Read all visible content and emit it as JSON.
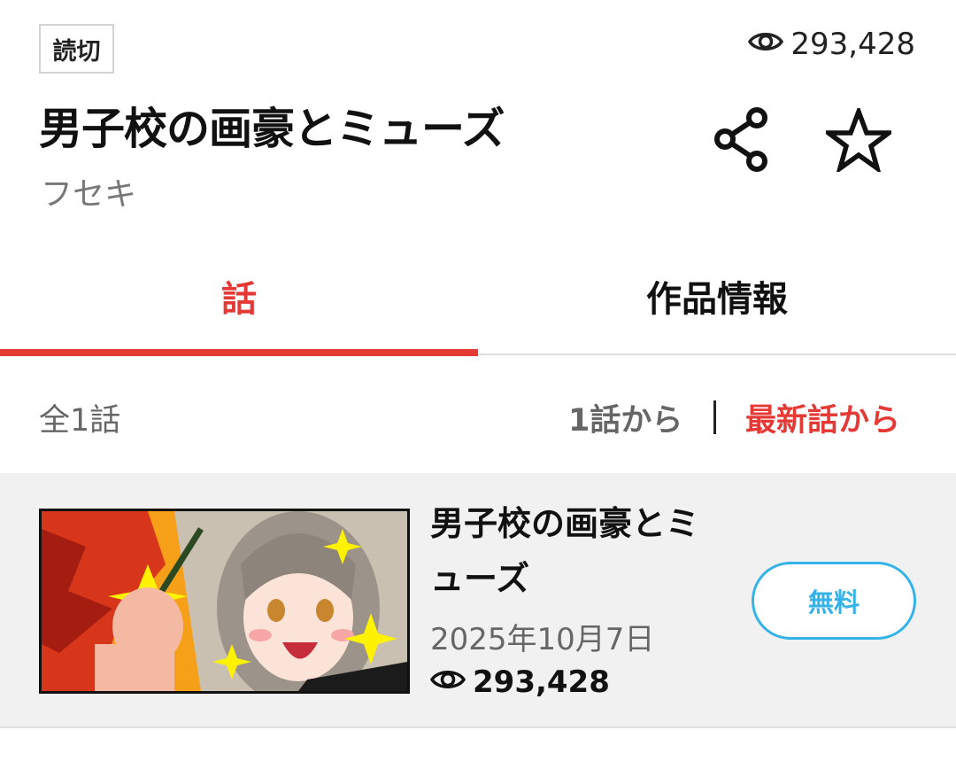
{
  "work": {
    "badge": "読切",
    "views": "293,428",
    "title": "男子校の画豪とミューズ",
    "author": "フセキ"
  },
  "icons": {
    "views": "eye-icon",
    "share": "share-icon",
    "favorite": "star-outline-icon"
  },
  "tabs": [
    {
      "label": "話",
      "active": true
    },
    {
      "label": "作品情報",
      "active": false
    }
  ],
  "list": {
    "count": "全1話",
    "sort_first": "1話から",
    "sort_latest": "最新話から"
  },
  "episodes": [
    {
      "title": "男子校の画豪とミューズ",
      "date": "2025年10月7日",
      "views": "293,428",
      "price_label": "無料"
    }
  ],
  "colors": {
    "accent_red": "#e53935",
    "accent_blue": "#35b3e8",
    "list_bg": "#f1f1f1"
  }
}
